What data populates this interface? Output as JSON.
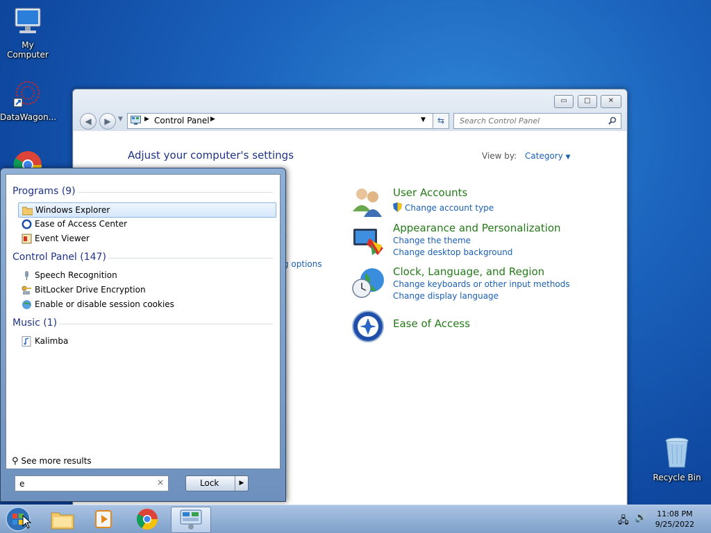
{
  "desktop": {
    "icons": [
      {
        "label": "My Computer",
        "icon": "computer-icon"
      },
      {
        "label": "DataWagon...",
        "icon": "datawagon-icon"
      },
      {
        "label": "Recycle Bin",
        "icon": "recycle-bin-icon"
      }
    ]
  },
  "window": {
    "buttons": {
      "minimize": "▭",
      "maximize": "□",
      "close": "✕"
    },
    "address": {
      "crumb": "Control Panel"
    },
    "search": {
      "placeholder": "Search Control Panel"
    },
    "title": "Adjust your computer's settings",
    "view_by": {
      "label": "View by:",
      "value": "Category"
    },
    "partial_link": "g options",
    "categories": [
      {
        "title": "User Accounts",
        "icon": "user-accounts-icon",
        "links": [
          "Change account type"
        ]
      },
      {
        "title": "Appearance and Personalization",
        "icon": "appearance-icon",
        "links": [
          "Change the theme",
          "Change desktop background"
        ]
      },
      {
        "title": "Clock, Language, and Region",
        "icon": "clock-globe-icon",
        "links": [
          "Change keyboards or other input methods",
          "Change display language"
        ]
      },
      {
        "title": "Ease of Access",
        "icon": "ease-of-access-icon",
        "links": []
      }
    ]
  },
  "start_menu": {
    "groups": [
      {
        "title": "Programs (9)",
        "items": [
          "Windows Explorer",
          "Ease of Access Center",
          "Event Viewer"
        ]
      },
      {
        "title": "Control Panel (147)",
        "items": [
          "Speech Recognition",
          "BitLocker Drive Encryption",
          "Enable or disable session cookies"
        ]
      },
      {
        "title": "Music (1)",
        "items": [
          "Kalimba"
        ]
      }
    ],
    "see_more": "See more results",
    "search_value": "e",
    "lock_label": "Lock"
  },
  "taskbar": {
    "apps": [
      "start-orb",
      "file-explorer",
      "media-player",
      "chrome",
      "control-panel"
    ],
    "time": "11:08 PM",
    "date": "9/25/2022"
  }
}
